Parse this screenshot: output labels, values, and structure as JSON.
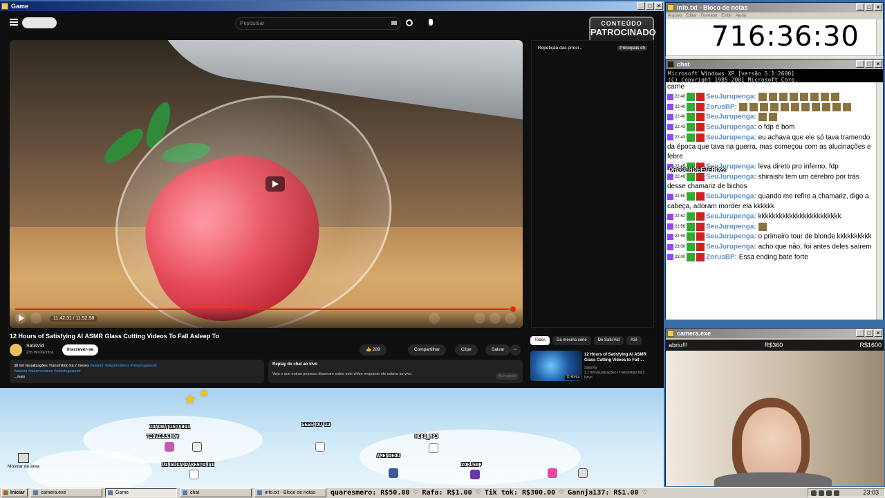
{
  "game_window": {
    "title": "Game"
  },
  "youtube": {
    "search_placeholder": "Pesquisar",
    "sponsor_line1": "CONTEÚDO",
    "sponsor_line2": "PATROCINADO",
    "player": {
      "time": "11:42:31 / 11:52:58",
      "progress_fraction": 0.983
    },
    "video_title": "12 Hours of Satisfying AI ASMR Glass Cutting Videos To Fall Asleep To",
    "channel_name": "SatisVid",
    "subscribers": "235 mil inscritos",
    "subscribe_label": "Inscrever-se",
    "likes": "289",
    "share_label": "Compartilhar",
    "clip_label": "Clipe",
    "save_label": "Salvar",
    "description_line1": "38 mil visualizações  Transmitido há 2 meses",
    "description_tags1": "#aiasmr #aiasmrvideos #relaxingaiasmr",
    "description_tags2": "#aiasmr #aiasmrvideos #relaxingaiasmr",
    "description_more": "...mais",
    "replay_title": "Replay do chat ao vivo",
    "replay_text": "Veja o que outras pessoas disseram sobre este vídeo enquanto ele estava ao vivo.",
    "replay_button": "Abrir painel",
    "side_chat_title": "Repetição das princi...",
    "side_chat_tab": "Principais ch",
    "chips": [
      "Todos",
      "Da mesma série",
      "De SatisVid",
      "ASI"
    ],
    "rec": {
      "title": "12 Hours of Satisfying AI ASMR Glass Cutting Videos to Fall ...",
      "channel": "SatisVid",
      "meta": "3,1 mil visualizações • Transmitido há 3 ...",
      "badge": "Novo",
      "duration": "11:50:54"
    }
  },
  "game": {
    "names": [
      {
        "id": "joao",
        "text": "JOAOBATISTA001"
      },
      {
        "id": "tiovillelhow",
        "text": "TIOVILLEHOW"
      },
      {
        "id": "lingu",
        "text": "LINGUCANDARESTINAI"
      },
      {
        "id": "sesshou",
        "text": "SESSHOU'23"
      },
      {
        "id": "hero",
        "text": "HERO_MP3"
      },
      {
        "id": "amendeou",
        "text": "AMENDEOU"
      },
      {
        "id": "zorus",
        "text": "ZORUSBP"
      }
    ],
    "desktop_icon": "Mostrar de área"
  },
  "notepad": {
    "title": "info.txt - Bloco de notas",
    "menu": "Arquivo  Editar  Formatar  Exibir  Ajuda",
    "text": "716:36:30"
  },
  "chat": {
    "title": "chat",
    "header1": "Microsoft Windows XP [versão 5.1.2600]",
    "header2": "(C) Copyright 1985-2001 Microsoft Corp.",
    "first_line": "carne",
    "messages": [
      {
        "time": "22:40",
        "user": "SeuJurupenga:",
        "text": "",
        "emotes": 8
      },
      {
        "time": "22:40",
        "user": "ZorusBP:",
        "text": "",
        "emotes": 11
      },
      {
        "time": "22:40",
        "user": "SeuJurupenga:",
        "text": "",
        "emotes": 2
      },
      {
        "time": "22:43",
        "user": "SeuJurupenga:",
        "text": "o fdp é bom",
        "emotes": 0
      },
      {
        "time": "22:43",
        "user": "SeuJurupenga:",
        "text": "eu achava que ele só tava tramendo da época que tava na guerra, mas começou com as alucinações e febre",
        "emotes": 0
      },
      {
        "time": "22:45",
        "user": "SeuJurupenga:",
        "text": "leva direto pro inferno, fdp",
        "emotes": 0
      },
      {
        "time": "22:49",
        "user": "SeuJurupenga:",
        "text": "shiraishi tem um cérebro por trás desse chamariz de bichos",
        "emotes": 0
      },
      {
        "time": "22:50",
        "user": "SeuJurupenga:",
        "text": "quando me refiro a chamariz, digo a cabeça, adoram morder ela kkkkkk",
        "emotes": 0
      },
      {
        "time": "22:52",
        "user": "SeuJurupenga:",
        "text": "kkkkkkkkkkkkkkkkkkkkkkkk",
        "emotes": 0
      },
      {
        "time": "22:56",
        "user": "SeuJurupenga:",
        "text": "",
        "emotes": 1
      },
      {
        "time": "22:59",
        "user": "SeuJurupenga:",
        "text": "o primeiro tour de blonde kkkkkkkkkk",
        "emotes": 0
      },
      {
        "time": "23:00",
        "user": "SeuJurupenga:",
        "text": "acho que não, foi antes deles saírem",
        "emotes": 0
      },
      {
        "time": "23:00",
        "user": "ZorusBP:",
        "text": "Essa ending bate forte",
        "emotes": 0
      }
    ],
    "overlay_name": "ORGULHOHETERO22"
  },
  "camera": {
    "title": "camera.exe",
    "left": "abriu!!!",
    "mid": "R$360",
    "right": "R$1600"
  },
  "taskbar": {
    "start": "Iniciar",
    "items": [
      "camera.exe",
      "Game",
      "chat",
      "info.txt - Bloco de notas"
    ],
    "ticker": "quaresmero: R$50.00 ♡ Rafa: R$1.00 ♡ Tik tok: R$300.00 ♡ Gannja137: R$1.00 ♡",
    "clock": "23:03"
  },
  "colors": {
    "progress": "#ee2211",
    "link": "#3ea6ff",
    "chat_user": "#5b8fc7",
    "twitch": "#9146ff"
  }
}
